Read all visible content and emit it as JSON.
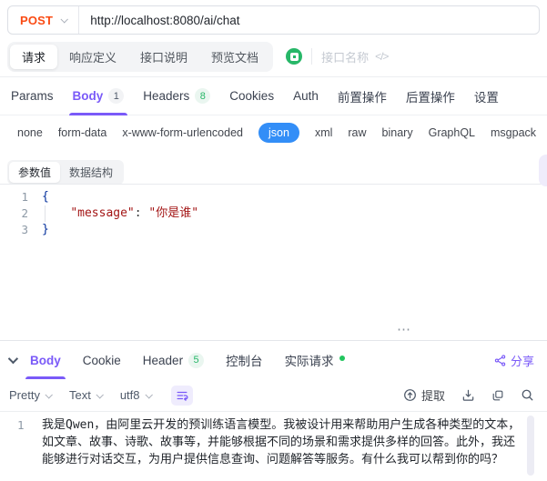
{
  "colors": {
    "accent_purple": "#7a5af8",
    "method_post_orange": "#fa4b14",
    "json_pill_blue": "#338ef7",
    "success_green": "#27b768",
    "status_dot_green": "#22c55e",
    "code_string_red": "#a31515",
    "code_brace_navy": "#04309c"
  },
  "request_bar": {
    "method": "POST",
    "url": "http://localhost:8080/ai/chat"
  },
  "view_tabs": {
    "items": [
      "请求",
      "响应定义",
      "接口说明",
      "预览文档"
    ],
    "active": "请求",
    "endpoint_name_placeholder": "接口名称",
    "code_glyph": "</>"
  },
  "request_tabs": {
    "active": "Body",
    "items": [
      {
        "label": "Params",
        "badge": ""
      },
      {
        "label": "Body",
        "badge": "1"
      },
      {
        "label": "Headers",
        "badge": "8"
      },
      {
        "label": "Cookies",
        "badge": ""
      },
      {
        "label": "Auth",
        "badge": ""
      },
      {
        "label": "前置操作",
        "badge": ""
      },
      {
        "label": "后置操作",
        "badge": ""
      },
      {
        "label": "设置",
        "badge": ""
      }
    ]
  },
  "body_types": {
    "active": "json",
    "options": [
      "none",
      "form-data",
      "x-www-form-urlencoded",
      "json",
      "xml",
      "raw",
      "binary",
      "GraphQL",
      "msgpack"
    ]
  },
  "editor": {
    "mode_tabs": [
      "参数值",
      "数据结构"
    ],
    "active_mode": "参数值",
    "line_numbers": [
      "1",
      "2",
      "3"
    ],
    "code": {
      "open_brace": "{",
      "indent": "    ",
      "key": "\"message\"",
      "separator": ": ",
      "value": "\"你是谁\"",
      "close_brace": "}"
    }
  },
  "splitter": {
    "handle": "⋯"
  },
  "response_panel": {
    "active": "Body",
    "tabs": [
      {
        "label": "Body",
        "badge": ""
      },
      {
        "label": "Cookie",
        "badge": ""
      },
      {
        "label": "Header",
        "badge": "5"
      },
      {
        "label": "控制台",
        "badge": ""
      },
      {
        "label": "实际请求",
        "badge": ""
      }
    ],
    "share_label": "分享",
    "toolbar": {
      "format": "Pretty",
      "view": "Text",
      "encoding": "utf8",
      "extract_label": "提取"
    },
    "body": {
      "line_number": "1",
      "text": "我是Qwen，由阿里云开发的预训练语言模型。我被设计用来帮助用户生成各种类型的文本，如文章、故事、诗歌、故事等，并能够根据不同的场景和需求提供多样的回答。此外，我还能够进行对话交互，为用户提供信息查询、问题解答等服务。有什么我可以帮到你的吗？"
    }
  }
}
